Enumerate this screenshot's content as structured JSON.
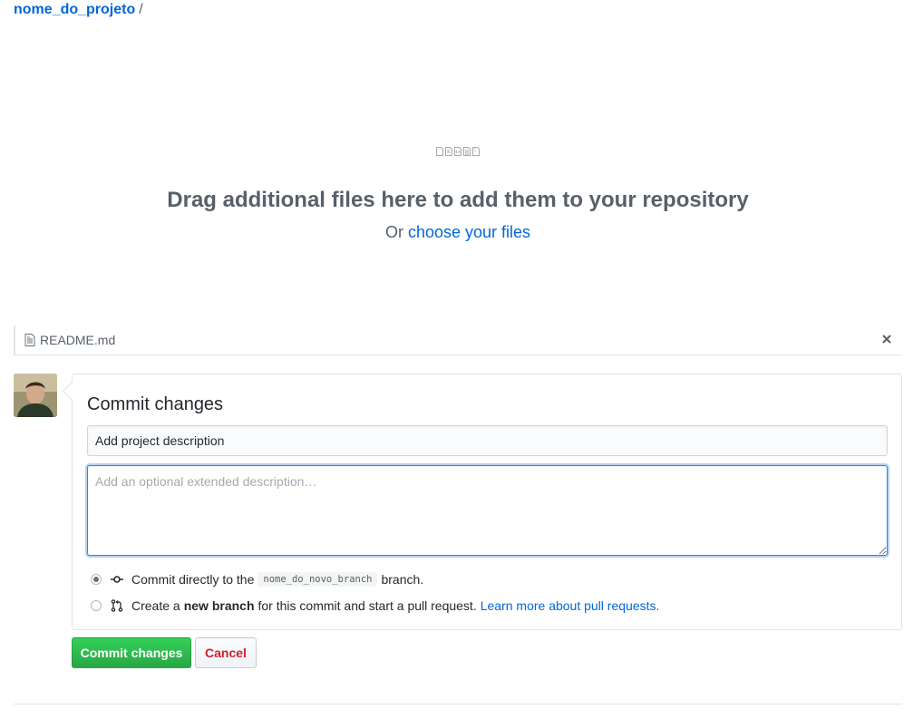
{
  "breadcrumb": {
    "repo": "nome_do_projeto",
    "separator": "/"
  },
  "dropzone": {
    "title": "Drag additional files here to add them to your repository",
    "prefix": "Or",
    "link": "choose your files",
    "icons": [
      "file-icon",
      "file-pdf-icon",
      "file-code-icon",
      "file-text-icon",
      "file-zip-icon"
    ]
  },
  "file": {
    "name": "README.md",
    "icon": "file-text-icon",
    "remove_icon": "close-icon"
  },
  "commit": {
    "title": "Commit changes",
    "summary_value": "Add project description",
    "description_placeholder": "Add an optional extended description…",
    "option_direct": {
      "prefix": "Commit directly to the",
      "branch": "nome_do_novo_branch",
      "suffix": "branch.",
      "selected": true
    },
    "option_new": {
      "prefix": "Create a",
      "bold": "new branch",
      "suffix": "for this commit and start a pull request.",
      "link": "Learn more about pull requests.",
      "selected": false
    }
  },
  "buttons": {
    "commit": "Commit changes",
    "cancel": "Cancel"
  },
  "colors": {
    "link": "#0366d6",
    "primary_button": "#28a745",
    "danger": "#cb2431",
    "focus_border": "#2188ff"
  }
}
